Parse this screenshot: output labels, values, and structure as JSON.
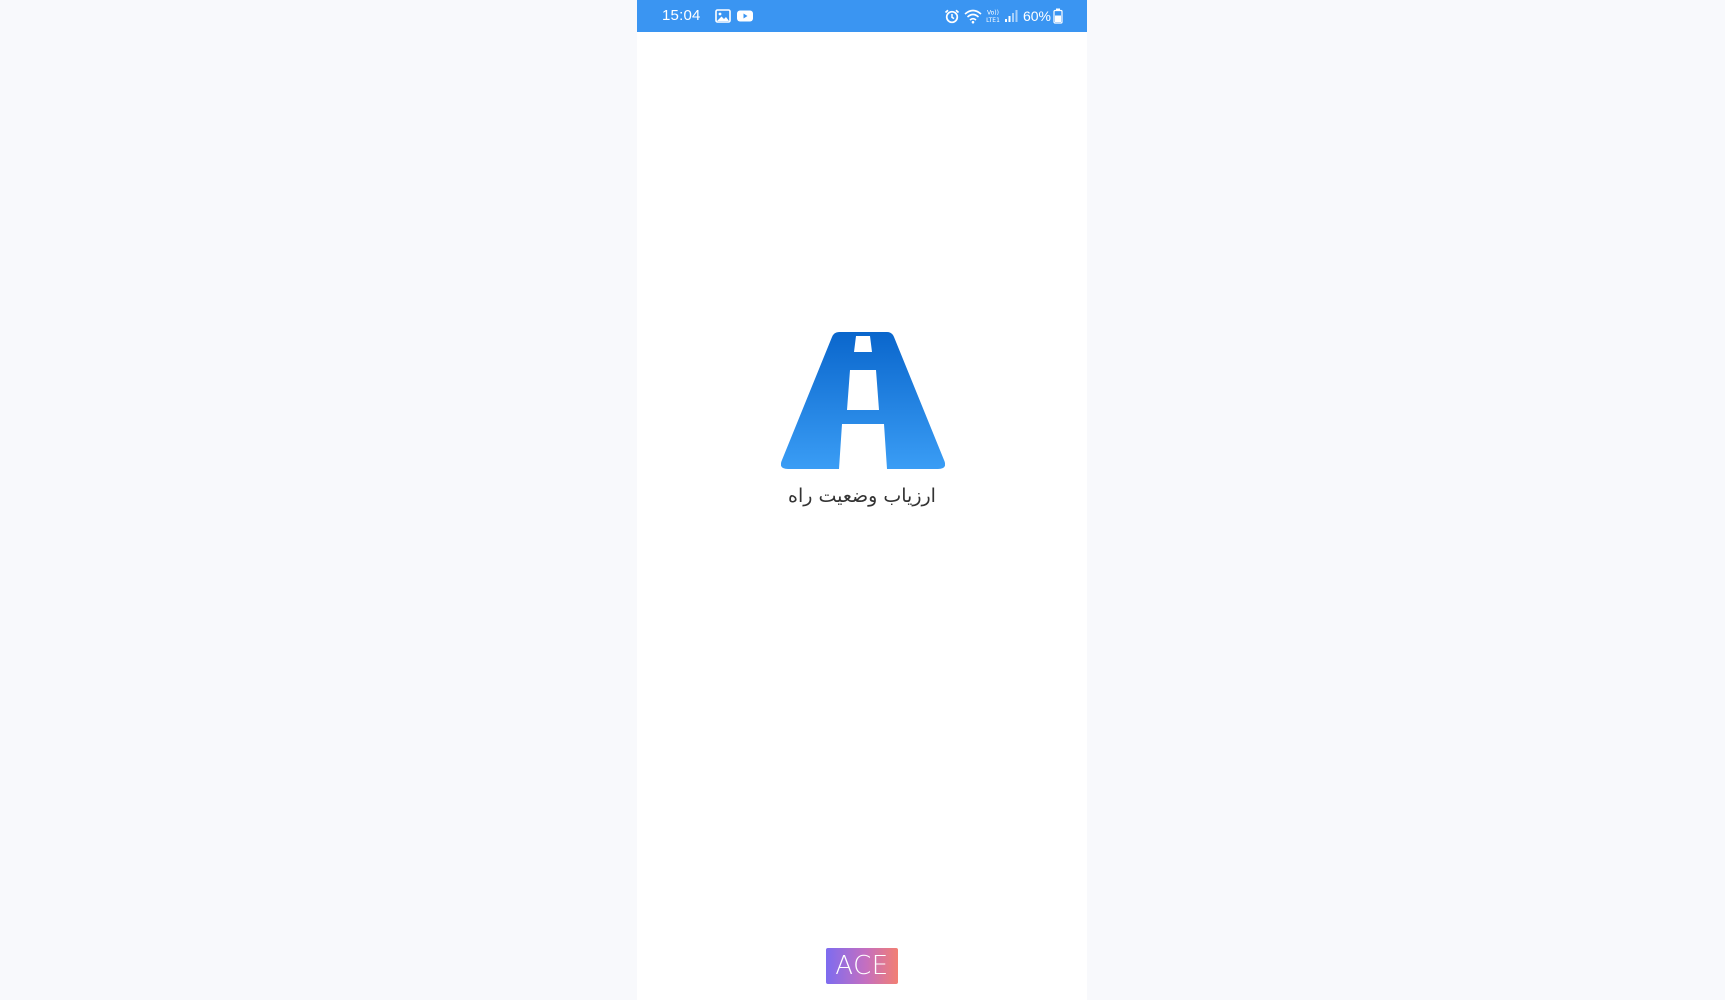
{
  "status_bar": {
    "time": "15:04",
    "battery_percent": "60%",
    "background_color": "#3a95f2",
    "left_icons": [
      "gallery-icon",
      "youtube-icon"
    ],
    "right_icons": [
      "alarm-icon",
      "wifi-icon",
      "volte-lte-icon",
      "signal-icon",
      "battery-icon"
    ]
  },
  "splash": {
    "app_name": "ارزیاب وضعیت راه",
    "logo_icon": "road-icon",
    "logo_colors": [
      "#0a66cc",
      "#3a9df5"
    ]
  },
  "brand_badge": {
    "label": "ACE"
  }
}
